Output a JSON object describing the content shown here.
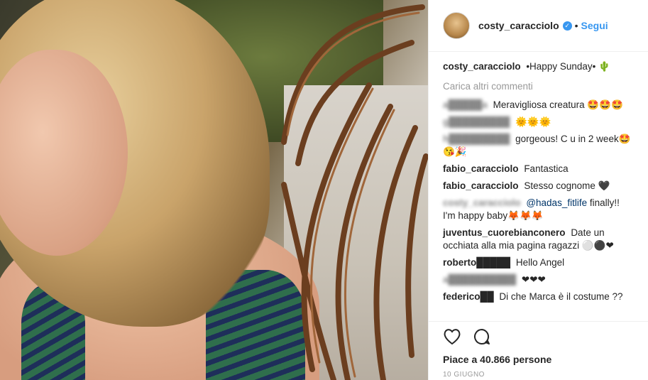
{
  "post": {
    "username": "costy_caracciolo",
    "follow_label": "Segui",
    "separator": "•",
    "caption_text": "•Happy Sunday• 🌵",
    "load_more": "Carica altri commenti",
    "likes": "Piace a 40.866 persone",
    "date": "10 GIUGNO"
  },
  "comments": [
    {
      "user": "a█████a",
      "text": "Meravigliosa creatura 🤩🤩🤩",
      "user_blurred": true
    },
    {
      "user": "g█████████",
      "text": "🌞🌞🌞",
      "user_blurred": true
    },
    {
      "user": "h█████████",
      "text": "gorgeous! C u in 2 week🤩😘🎉",
      "user_blurred": true
    },
    {
      "user": "fabio_caracciolo",
      "text": "Fantastica",
      "user_blurred": true
    },
    {
      "user": "fabio_caracciolo",
      "text": "Stesso cognome 🖤",
      "user_blurred": true
    },
    {
      "user": "costy_caracciolo",
      "mention": "@hadas_fitlife",
      "text": "finally!! I'm happy baby🦊🦊🦊",
      "user_blurred": true
    },
    {
      "user": "juventus_cuorebianconero",
      "text": "Date un occhiata alla mia pagina ragazzi ⚪⚫❤",
      "user_blurred": false
    },
    {
      "user": "roberto█████",
      "text": "Hello Angel",
      "user_blurred": true
    },
    {
      "user": "a██████████",
      "text": "❤❤❤",
      "user_blurred": true
    },
    {
      "user": "federico██",
      "text": "Di che Marca è il costume ??",
      "user_blurred": true
    }
  ],
  "icons": {
    "like": "heart-icon",
    "comment": "comment-icon",
    "verified": "verified-badge-icon"
  },
  "colors": {
    "link": "#3897f0",
    "text": "#262626",
    "muted": "#999999"
  }
}
